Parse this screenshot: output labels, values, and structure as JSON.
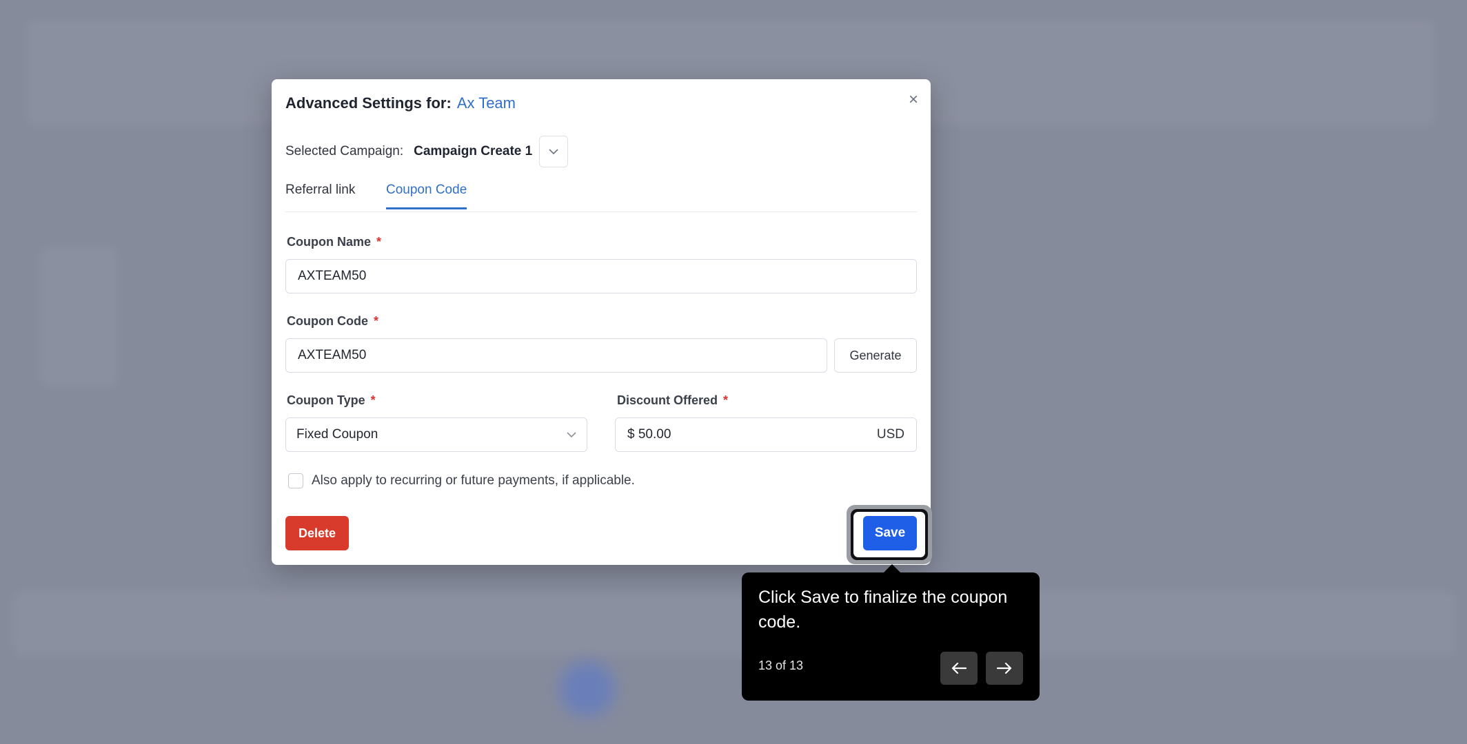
{
  "modal": {
    "title_prefix": "Advanced Settings for:",
    "team_name": "Ax Team",
    "close_glyph": "×",
    "campaign_label": "Selected Campaign:",
    "campaign_value": "Campaign Create 1",
    "tabs": [
      {
        "label": "Referral link",
        "active": false
      },
      {
        "label": "Coupon Code",
        "active": true
      }
    ],
    "coupon_name": {
      "label": "Coupon Name",
      "required": "*",
      "value": "AXTEAM50"
    },
    "coupon_code": {
      "label": "Coupon Code",
      "required": "*",
      "value": "AXTEAM50",
      "generate_label": "Generate"
    },
    "coupon_type": {
      "label": "Coupon Type",
      "required": "*",
      "value": "Fixed Coupon"
    },
    "discount": {
      "label": "Discount Offered",
      "required": "*",
      "value": "$ 50.00",
      "currency": "USD"
    },
    "recurring_text": "Also apply to recurring or future payments, if applicable.",
    "delete_label": "Delete",
    "save_label": "Save"
  },
  "tooltip": {
    "text": "Click Save to finalize the coupon code.",
    "step": "13 of 13",
    "prev_icon": "arrow-left-icon",
    "next_icon": "arrow-right-icon"
  },
  "colors": {
    "accent": "#2f6fcb",
    "save": "#1f5fe8",
    "delete": "#d83a2b",
    "required": "#dd3333"
  }
}
